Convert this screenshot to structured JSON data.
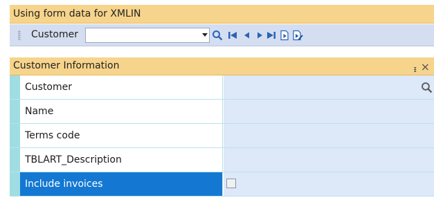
{
  "window": {
    "title": "Using form data for XMLIN"
  },
  "toolbar": {
    "customer_label": "Customer",
    "customer_value": "",
    "buttons": [
      "search-icon",
      "first-record-icon",
      "previous-record-icon",
      "next-record-icon",
      "last-record-icon",
      "new-record-icon",
      "edit-record-icon"
    ]
  },
  "panel": {
    "title": "Customer Information",
    "pin_glyph": "ᵻ",
    "close_glyph": "×",
    "rows": [
      {
        "label": "Customer",
        "value": ""
      },
      {
        "label": "Name",
        "value": ""
      },
      {
        "label": "Terms code",
        "value": ""
      },
      {
        "label": "TBLART_Description",
        "value": ""
      },
      {
        "label": "Include invoices",
        "checked": false,
        "selected": true
      }
    ]
  },
  "colors": {
    "header": "#f7d48c",
    "toolbar": "#d4def0",
    "value_cell": "#dde8f8",
    "selection": "#1478d2",
    "accent_icon": "#2a62b8"
  }
}
